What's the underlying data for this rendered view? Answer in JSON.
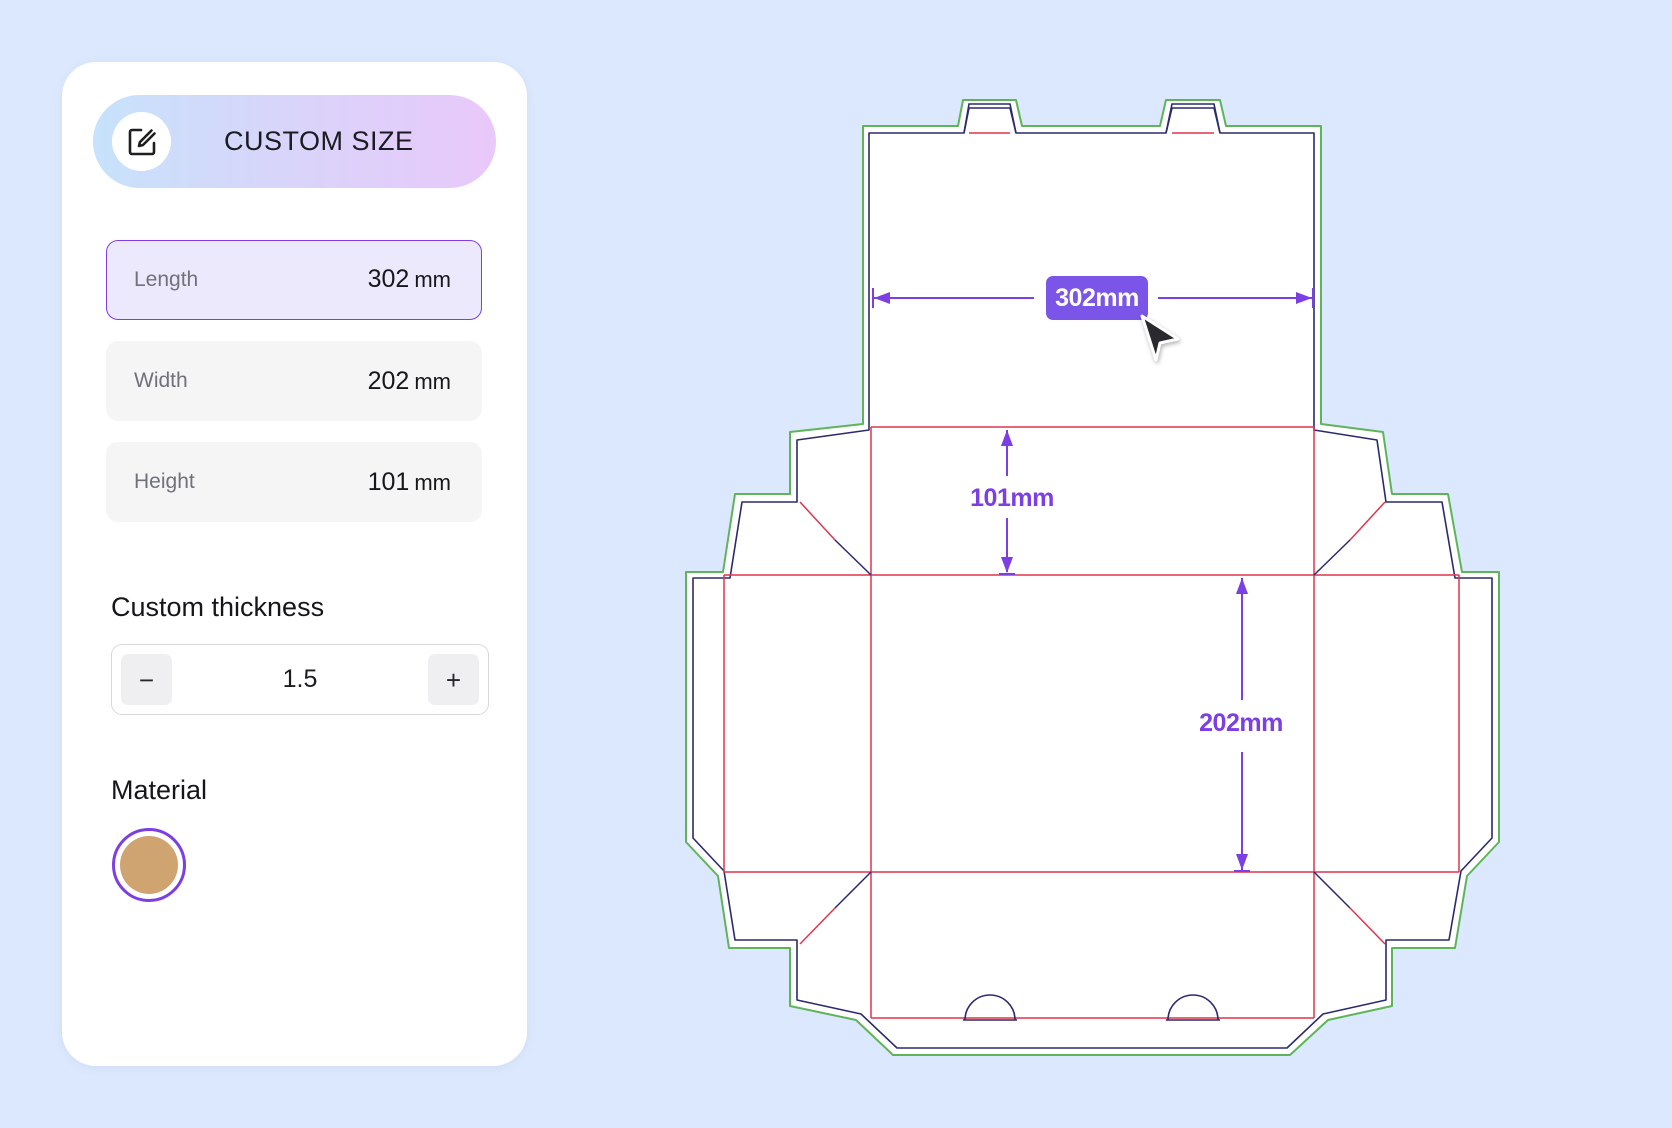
{
  "header": {
    "title": "CUSTOM SIZE",
    "icon": "edit-icon"
  },
  "fields": {
    "length": {
      "label": "Length",
      "value": "302",
      "unit": "mm"
    },
    "width": {
      "label": "Width",
      "value": "202",
      "unit": "mm"
    },
    "height": {
      "label": "Height",
      "value": "101",
      "unit": "mm"
    }
  },
  "thickness": {
    "title": "Custom thickness",
    "value": "1.5",
    "minus": "−",
    "plus": "+"
  },
  "material": {
    "title": "Material",
    "selected_color": "#cfa470"
  },
  "dieline": {
    "length_label": "302mm",
    "height_label": "101mm",
    "width_label": "202mm"
  },
  "colors": {
    "accent": "#7b3fe4",
    "cut_line": "#2b2a6e",
    "fold_line": "#e0344d",
    "bleed_line": "#3aa43a"
  }
}
